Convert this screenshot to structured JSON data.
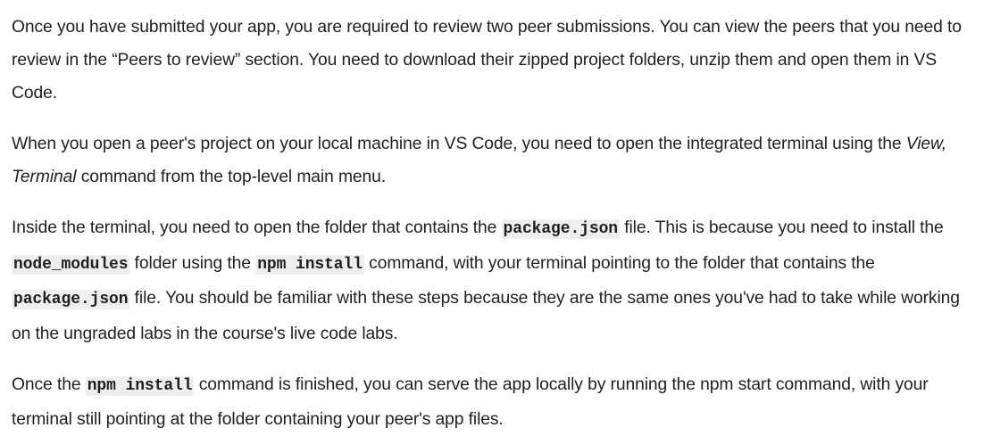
{
  "paragraphs": [
    {
      "text": "Once you have submitted your app, you are required to review two peer submissions. You can view the peers that you need to review in the “Peers to review” section. You need to download their zipped project folders, unzip them and open them in VS Code."
    },
    {
      "before": "When you open a peer's project on your local machine in VS Code, you need to open the integrated terminal using the ",
      "italic": "View, Terminal",
      "after": " command from the top-level main menu."
    },
    {
      "t1": "Inside the terminal, you need to open the folder that contains the ",
      "c1": "package.json",
      "t2": " file. This is because you need to install the ",
      "c2": "node_modules",
      "t3": " folder using the ",
      "c3": "npm install",
      "t4": " command, with your terminal pointing to the folder that contains the ",
      "c4": "package.json",
      "t5": " file. You should be familiar with these steps because they are the same ones you've had to take while working on the ungraded labs in the course's live code labs."
    },
    {
      "t1": "Once the ",
      "c1": "npm install",
      "t2": " command is finished, you can serve the app locally by running the npm start command, with your terminal still pointing at the folder containing your peer's app files."
    }
  ]
}
